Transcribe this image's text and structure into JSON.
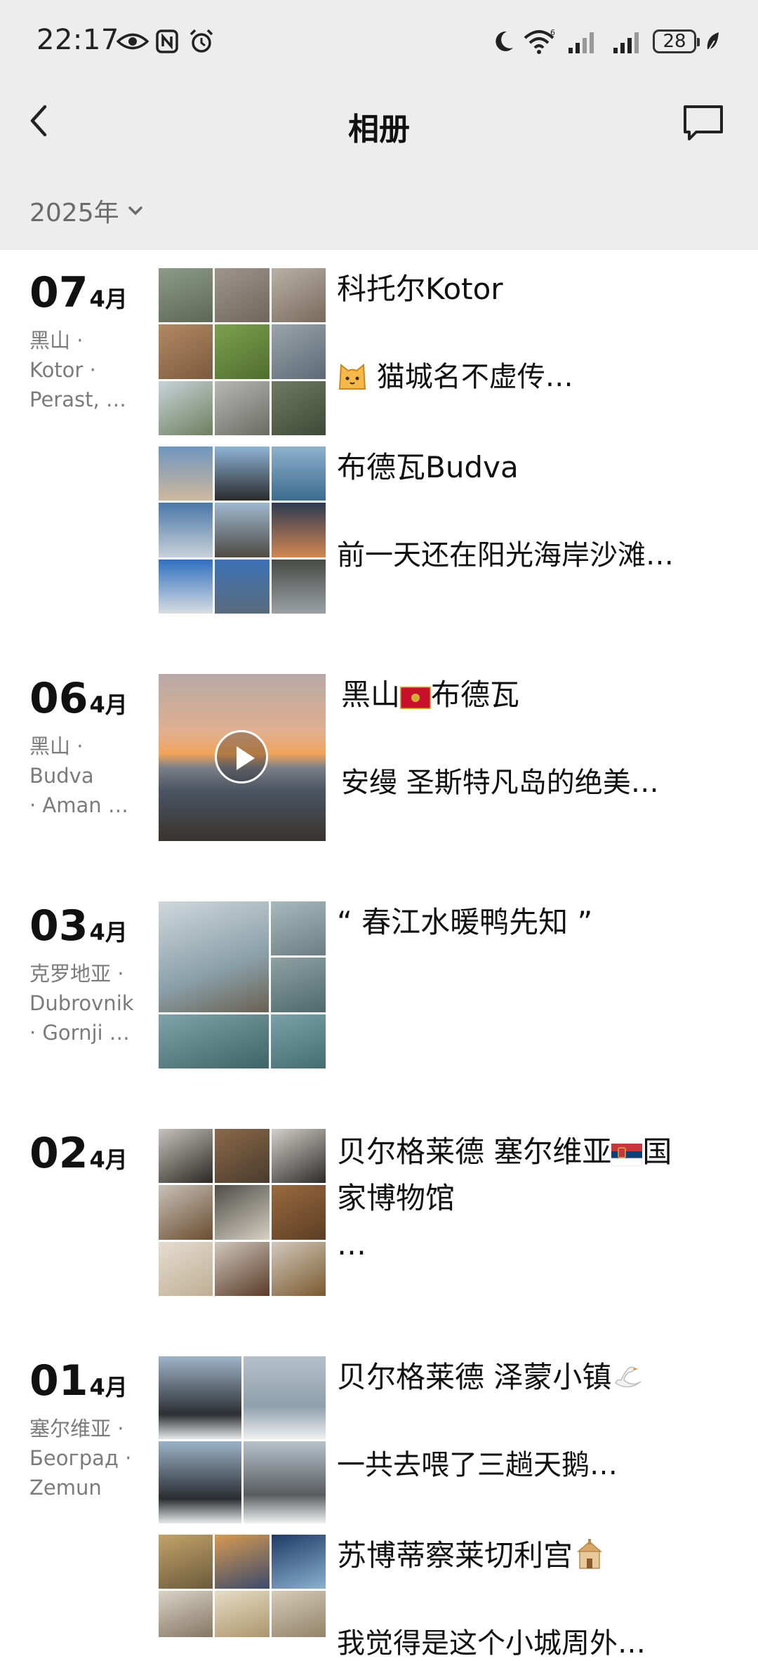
{
  "status": {
    "time": "22:17",
    "battery": "28"
  },
  "nav": {
    "title": "相册"
  },
  "year_selector": {
    "label": "2025年"
  },
  "entries": [
    {
      "day": "07",
      "month": "4月",
      "location": [
        "黑山 ·",
        "Kotor ·",
        "Perast, …"
      ],
      "posts": [
        {
          "title": "科托尔Kotor",
          "caption": "猫城名不虚传…",
          "caption_emoji": "cat-face"
        },
        {
          "title": "布德瓦Budva",
          "caption": "前一天还在阳光海岸沙滩…"
        }
      ]
    },
    {
      "day": "06",
      "month": "4月",
      "location": [
        "黑山 ·",
        "Budva",
        "· Aman …"
      ],
      "posts": [
        {
          "title_a": "黑山",
          "title_flag": "montenegro-flag",
          "title_b": "布德瓦",
          "caption": "安缦 圣斯特凡岛的绝美…",
          "media": "video"
        }
      ]
    },
    {
      "day": "03",
      "month": "4月",
      "location": [
        "克罗地亚 ·",
        "Dubrovnik",
        "· Gornji …"
      ],
      "posts": [
        {
          "title": "“ 春江水暖鸭先知 ”"
        }
      ]
    },
    {
      "day": "02",
      "month": "4月",
      "location": [],
      "posts": [
        {
          "line1_a": "贝尔格莱德  塞尔维亚",
          "line1_flag": "serbia-flag",
          "line1_b": "国",
          "line2": "家博物馆",
          "line3": "…"
        }
      ]
    },
    {
      "day": "01",
      "month": "4月",
      "location": [
        "塞尔维亚 ·",
        "Београд ·",
        "Zemun"
      ],
      "posts": [
        {
          "title": "贝尔格莱德  泽蒙小镇",
          "title_emoji": "swan",
          "caption": "一共去喂了三趟天鹅…"
        },
        {
          "title": "苏博蒂察莱切利宫",
          "title_emoji": "church",
          "caption": "我觉得是这个小城周外…"
        }
      ]
    }
  ]
}
